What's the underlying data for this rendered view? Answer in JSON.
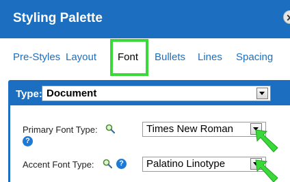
{
  "header": {
    "title": "Styling Palette",
    "close_icon": "close-icon"
  },
  "tabs": [
    {
      "label": "Pre-Styles"
    },
    {
      "label": "Layout"
    },
    {
      "label": "Font",
      "active": true
    },
    {
      "label": "Bullets"
    },
    {
      "label": "Lines"
    },
    {
      "label": "Spacing"
    }
  ],
  "type_select": {
    "label": "Type:",
    "value": "Document"
  },
  "primary_font": {
    "label": "Primary Font Type:",
    "value": "Times New Roman"
  },
  "accent_font": {
    "label": "Accent Font Type:",
    "value": "Palatino Linotype"
  },
  "colors": {
    "brand": "#1c6fc0",
    "highlight": "#3ad93a",
    "help": "#1f7ad6"
  }
}
